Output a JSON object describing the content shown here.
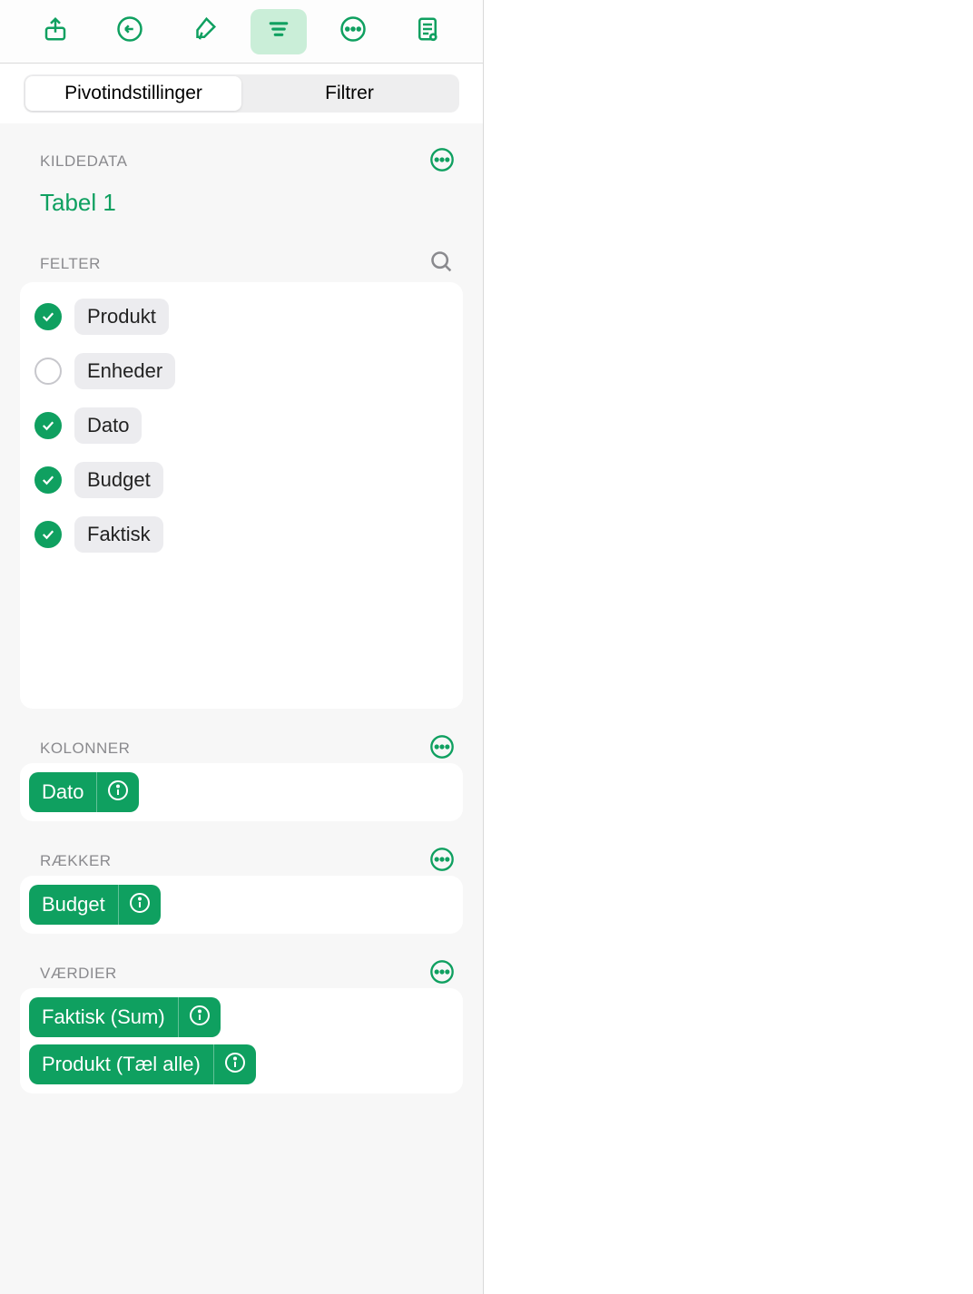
{
  "toolbar": {
    "share_icon": "share",
    "undo_icon": "undo",
    "brush_icon": "brush",
    "organize_icon": "organize",
    "more_icon": "more",
    "doc_review_icon": "doc-review"
  },
  "tabs": {
    "pivot_settings": "Pivotindstillinger",
    "filter": "Filtrer"
  },
  "source": {
    "section_label": "KILDEDATA",
    "table_name": "Tabel 1"
  },
  "fields": {
    "section_label": "FELTER",
    "items": [
      {
        "label": "Produkt",
        "checked": true
      },
      {
        "label": "Enheder",
        "checked": false
      },
      {
        "label": "Dato",
        "checked": true
      },
      {
        "label": "Budget",
        "checked": true
      },
      {
        "label": "Faktisk",
        "checked": true
      }
    ]
  },
  "columns": {
    "section_label": "KOLONNER",
    "items": [
      {
        "label": "Dato"
      }
    ]
  },
  "rows": {
    "section_label": "RÆKKER",
    "items": [
      {
        "label": "Budget"
      }
    ]
  },
  "values": {
    "section_label": "VÆRDIER",
    "items": [
      {
        "label": "Faktisk (Sum)"
      },
      {
        "label": "Produkt (Tæl alle)"
      }
    ]
  }
}
